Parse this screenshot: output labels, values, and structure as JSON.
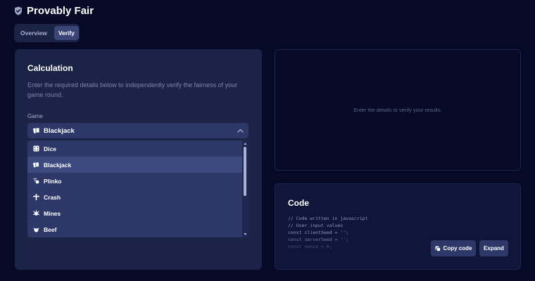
{
  "header": {
    "title": "Provably Fair",
    "icon": "shield-check-icon"
  },
  "tabs": [
    {
      "label": "Overview",
      "active": false
    },
    {
      "label": "Verify",
      "active": true
    }
  ],
  "calculation": {
    "title": "Calculation",
    "description": "Enter the required details below to independently verify the fairness of your game round.",
    "game_label": "Game",
    "selected_game": "Blackjack",
    "options": [
      {
        "label": "Dice",
        "icon": "dice-icon"
      },
      {
        "label": "Blackjack",
        "icon": "cards-icon"
      },
      {
        "label": "Plinko",
        "icon": "plinko-icon"
      },
      {
        "label": "Crash",
        "icon": "crash-icon"
      },
      {
        "label": "Mines",
        "icon": "mines-icon"
      },
      {
        "label": "Beef",
        "icon": "beef-icon"
      }
    ]
  },
  "results": {
    "empty_message": "Enter the details to verify your results."
  },
  "code": {
    "title": "Code",
    "lines": [
      "// Code written in javascript",
      "",
      "// User input values",
      "const clientSeed = '';",
      "const serverSeed = '';",
      "const nonce = 0;"
    ],
    "copy_label": "Copy code",
    "expand_label": "Expand"
  },
  "colors": {
    "background": "#060a26",
    "panel": "#1b2447",
    "control": "#2d3868",
    "selected": "#3d4a80",
    "muted_text": "#7d85ab"
  }
}
